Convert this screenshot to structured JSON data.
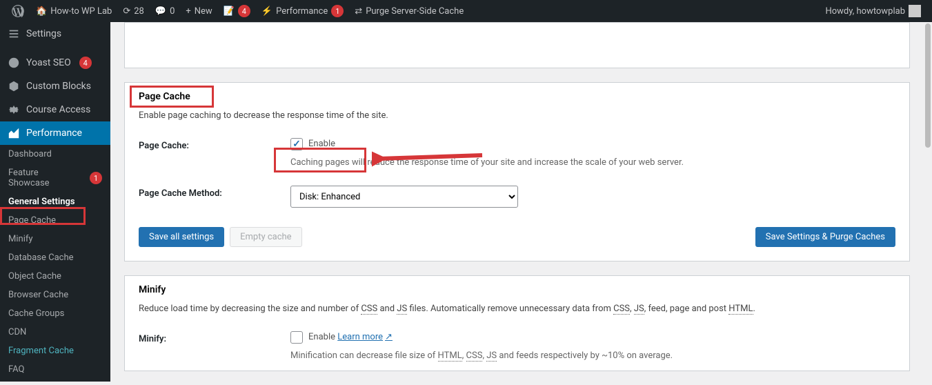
{
  "adminbar": {
    "site_name": "How-to WP Lab",
    "updates": "28",
    "comments": "0",
    "new": "New",
    "yoast_badge": "4",
    "performance": "Performance",
    "perf_badge": "1",
    "purge": "Purge Server-Side Cache",
    "howdy": "Howdy, howtowplab"
  },
  "sidebar": {
    "settings": "Settings",
    "yoast": "Yoast SEO",
    "yoast_badge": "4",
    "custom_blocks": "Custom Blocks",
    "course_access": "Course Access",
    "performance": "Performance",
    "subs": {
      "dashboard": "Dashboard",
      "feature_showcase": "Feature Showcase",
      "feature_badge": "1",
      "general_settings": "General Settings",
      "page_cache": "Page Cache",
      "minify": "Minify",
      "database_cache": "Database Cache",
      "object_cache": "Object Cache",
      "browser_cache": "Browser Cache",
      "cache_groups": "Cache Groups",
      "cdn": "CDN",
      "fragment_cache": "Fragment Cache",
      "faq": "FAQ"
    }
  },
  "page_cache": {
    "heading": "Page Cache",
    "desc": "Enable page caching to decrease the response time of the site.",
    "label1": "Page Cache:",
    "enable": "Enable",
    "enable_desc": "Caching pages will reduce the response time of your site and increase the scale of your web server.",
    "label2": "Page Cache Method:",
    "method": "Disk: Enhanced",
    "save_all": "Save all settings",
    "empty": "Empty cache",
    "save_purge": "Save Settings & Purge Caches"
  },
  "minify": {
    "heading": "Minify",
    "desc1": "Reduce load time by decreasing the size and number of ",
    "css": "CSS",
    "and": " and ",
    "js": "JS",
    "desc2": " files. Automatically remove unnecessary data from ",
    "desc3": ", feed, page and post ",
    "html": "HTML",
    "label": "Minify:",
    "enable": "Enable",
    "learn_more": "Learn more",
    "min_desc1": "Minification can decrease file size of ",
    "min_desc2": " and feeds respectively by ~10% on average."
  }
}
